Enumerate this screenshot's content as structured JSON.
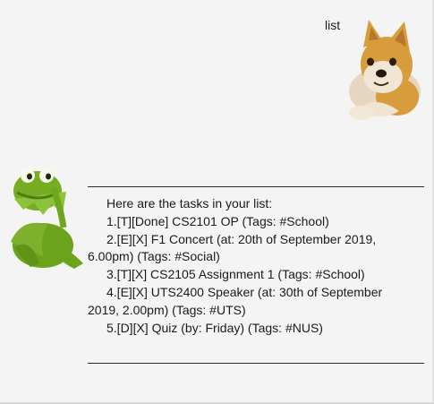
{
  "user_message": {
    "text": "list",
    "avatar": "doge-avatar"
  },
  "bot_message": {
    "avatar": "kermit-avatar",
    "intro": "Here are the tasks in your list:",
    "tasks": [
      {
        "line1": "1.[T][Done] CS2101 OP  (Tags: #School)"
      },
      {
        "line1": "2.[E][X] F1 Concert (at: 20th of September 2019,",
        "line2": "6.00pm) (Tags: #Social)"
      },
      {
        "line1": "3.[T][X] CS2105 Assignment 1  (Tags: #School)"
      },
      {
        "line1": "4.[E][X] UTS2400 Speaker (at: 30th of September",
        "line2": "2019, 2.00pm) (Tags: #UTS)"
      },
      {
        "line1": "5.[D][X] Quiz (by: Friday) (Tags: #NUS)"
      }
    ]
  }
}
